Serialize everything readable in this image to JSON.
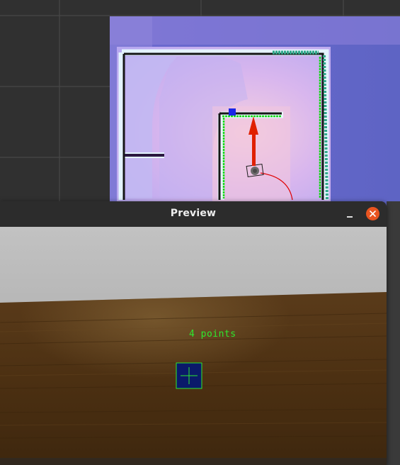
{
  "map_view": {
    "background_color": "#303030",
    "grid_color": "#4a4a4a",
    "goal_arrow_color": "#e02000",
    "robot_icon": "robot-icon",
    "marker_icon": "goal-marker-icon"
  },
  "preview_window": {
    "title": "Preview",
    "minimize_icon": "minimize-icon",
    "close_icon": "close-icon",
    "close_color": "#e95420",
    "points_label": "4 points",
    "overlay_color": "#2ee82e",
    "target_icon": "crosshair-icon"
  }
}
